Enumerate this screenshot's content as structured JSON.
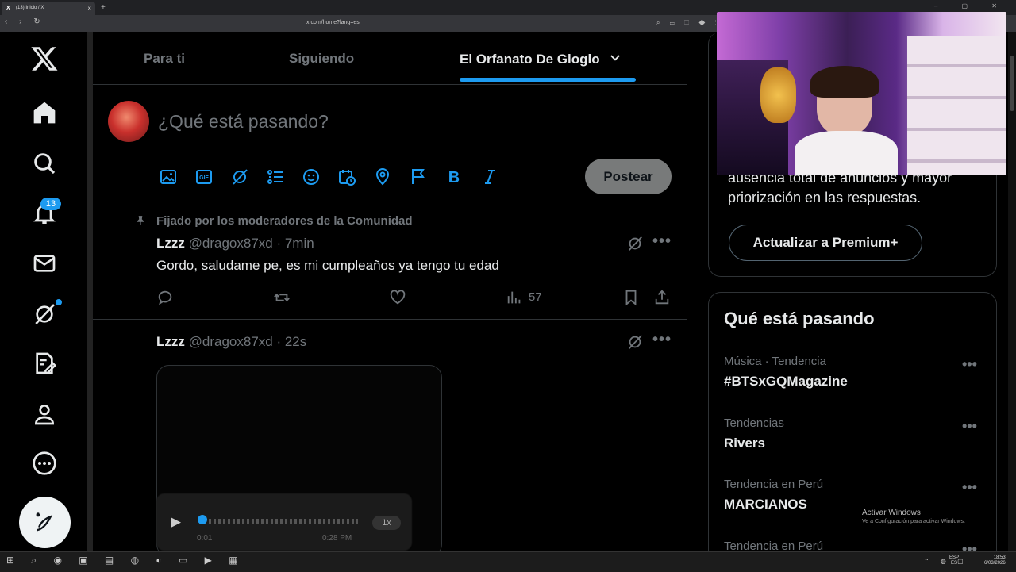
{
  "browser": {
    "tab_title": "(13) Inicio / X",
    "tab_close": "×",
    "new_tab": "+",
    "url": "x.com/home?lang=es",
    "nav_buttons": "‹ › ↻",
    "window_controls": "– ▢ ✕",
    "url_icons": "⌕ ▭ ⬚ ◆ ⋮"
  },
  "sidebar": {
    "notification_count": "13",
    "icons": [
      "x-logo-icon",
      "home-icon",
      "search-icon",
      "bell-icon",
      "mail-icon",
      "grok-icon",
      "premium-icon",
      "profile-icon",
      "more-icon",
      "compose-icon"
    ]
  },
  "tabs": {
    "for_you": "Para ti",
    "following": "Siguiendo",
    "community": "El Orfanato De Gloglo"
  },
  "composer": {
    "placeholder": "¿Qué está pasando?",
    "post_button": "Postear"
  },
  "feed": {
    "pinned_label": "Fijado por los moderadores de la Comunidad",
    "tweet1": {
      "name": "Lzzz",
      "handle_time": "@dragox87xd · 7min",
      "text": "Gordo, saludame pe, es mi cumpleaños ya tengo tu edad",
      "views": "57"
    },
    "tweet2": {
      "name": "Lzzz",
      "handle_time": "@dragox87xd · 22s",
      "audio_speed": "1x",
      "audio_elapsed": "0:01",
      "audio_total": "0:28 PM"
    }
  },
  "premium": {
    "text": "ausencia total de anuncios y mayor priorización en las respuestas.",
    "button": "Actualizar a Premium+"
  },
  "trends": {
    "title": "Qué está pasando",
    "items": [
      {
        "context": "Música · Tendencia",
        "name": "#BTSxGQMagazine"
      },
      {
        "context": "Tendencias",
        "name": "Rivers"
      },
      {
        "context": "Tendencia en Perú",
        "name": "MARCIANOS"
      },
      {
        "context": "Tendencia en Perú",
        "name": ""
      }
    ],
    "more": "•••"
  },
  "watermark": {
    "line1": "Activar Windows",
    "line2": "Ve a Configuración para activar Windows."
  },
  "taskbar": {
    "apps": "⊞ ⌕ ◉ ▣ ▤ ◍ ◐ ▭ ▶ ▦",
    "tray": "⌃ ◍ ▢",
    "lang_line1": "ESP",
    "lang_line2": "ES",
    "time": "18:53",
    "date": "6/03/2026"
  },
  "colors": {
    "accent": "#1d9bf0",
    "background": "#000000",
    "muted": "#71767b"
  }
}
